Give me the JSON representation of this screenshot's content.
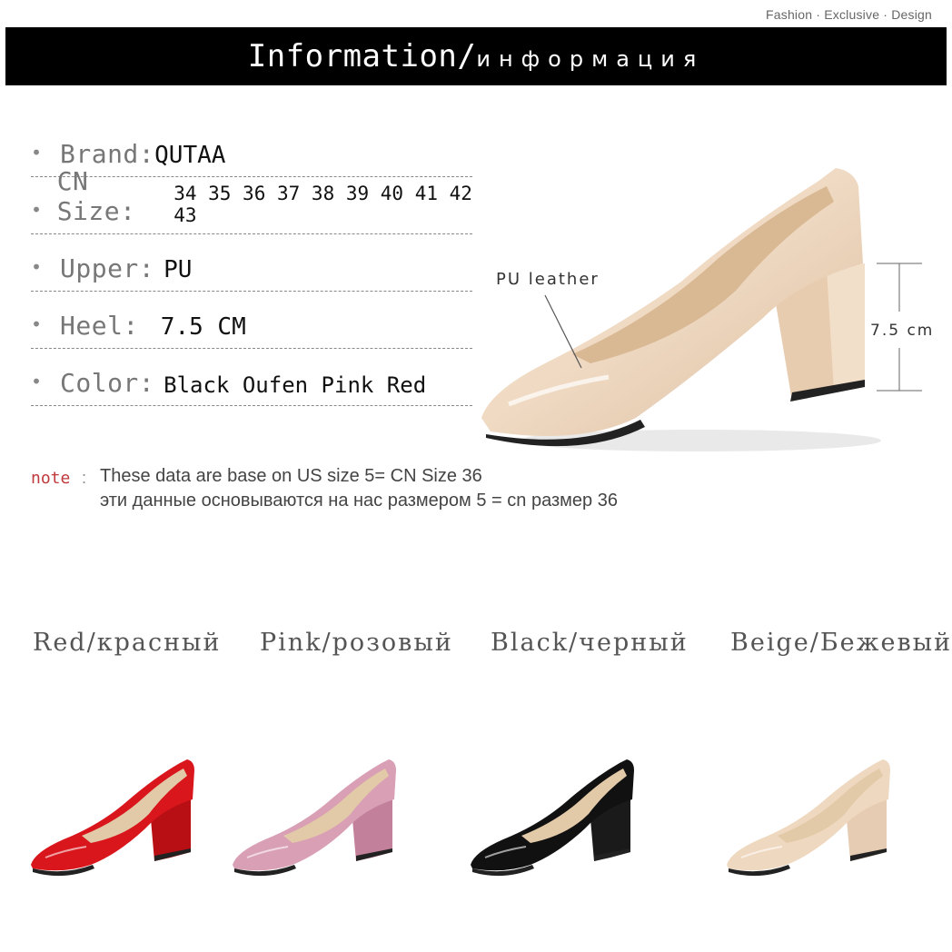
{
  "header": {
    "tagline": "Fashion · Exclusive · Design",
    "title_en": "Information/",
    "title_ru": "информация"
  },
  "specs": [
    {
      "bullet": "•",
      "label": "Brand:",
      "value": "QUTAA"
    },
    {
      "bullet": "•",
      "label": "CN Size:",
      "value": "34 35 36 37 38 39 40 41 42 43"
    },
    {
      "bullet": "•",
      "label": "Upper:",
      "value": "PU"
    },
    {
      "bullet": "•",
      "label": "Heel:",
      "value": "7.5 CM"
    },
    {
      "bullet": "•",
      "label": "Color:",
      "value": "Black Oufen Pink  Red"
    }
  ],
  "note": {
    "key": "note",
    "colon": ":",
    "line1": "These data are base on US size 5= CN Size 36",
    "line2": "эти данные основываются на нас размером 5 = cn размер 36"
  },
  "callouts": {
    "material": "PU leather",
    "heel": "7.5 cm"
  },
  "colors": [
    {
      "label": "Red/красный",
      "hex": "#d8161c",
      "heel_hex": "#b70f14"
    },
    {
      "label": "Pink/розовый",
      "hex": "#d99fb5",
      "heel_hex": "#c3809b"
    },
    {
      "label": "Black/черный",
      "hex": "#111111",
      "heel_hex": "#1a1a1a"
    },
    {
      "label": "Beige/Бежевый",
      "hex": "#efd8c0",
      "heel_hex": "#e6ccb2"
    }
  ],
  "hero_color": "#efd9c2"
}
